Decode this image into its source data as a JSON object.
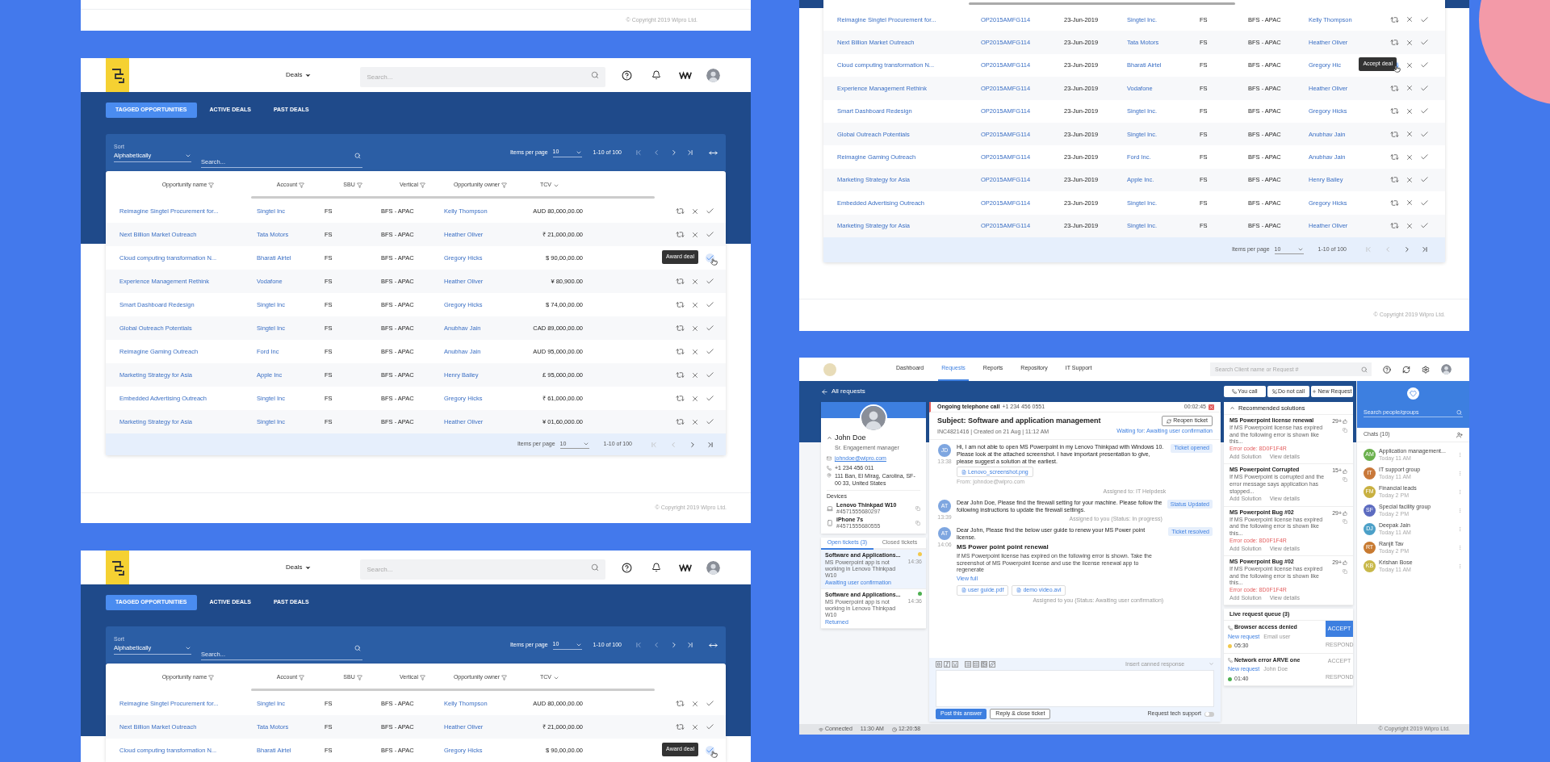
{
  "top_left_card": {
    "copyright": "© Copyright 2019 Wipro Ltd."
  },
  "deals_screen": {
    "menu": "Deals",
    "search_placeholder": "Search...",
    "tabs": [
      {
        "label": "TAGGED OPPORTUNITIES",
        "selected": true
      },
      {
        "label": "ACTIVE DEALS",
        "selected": false
      },
      {
        "label": "PAST DEALS",
        "selected": false
      }
    ],
    "filter": {
      "sort_label": "Sort",
      "sort_value": "Alphabetically",
      "search_placeholder": "Search...",
      "items_per_page_label": "Items per page",
      "items_per_page": "10",
      "range": "1-10 of 100"
    },
    "columns": [
      {
        "label": "Opportunity name",
        "kind": "filter"
      },
      {
        "label": "Account",
        "kind": "filter"
      },
      {
        "label": "SBU",
        "kind": "filter"
      },
      {
        "label": "Vertical",
        "kind": "filter"
      },
      {
        "label": "Opportunity owner",
        "kind": "filter"
      },
      {
        "label": "TCV",
        "kind": "sort"
      }
    ],
    "rows": [
      {
        "name": "Reimagine Singtel Procurement for...",
        "account": "Singtel Inc",
        "sbu": "FS",
        "vertical": "BFS - APAC",
        "owner": "Kelly Thompson",
        "tcv": "AUD 80,000,00.00"
      },
      {
        "name": "Next Billion Market Outreach",
        "account": "Tata Motors",
        "sbu": "FS",
        "vertical": "BFS - APAC",
        "owner": "Heather Oliver",
        "tcv": "₹ 21,000,00.00"
      },
      {
        "name": "Cloud computing transformation N...",
        "account": "Bharati Airtel",
        "sbu": "FS",
        "vertical": "BFS - APAC",
        "owner": "Gregory Hicks",
        "tcv": "$ 90,00,00.00",
        "tooltip": "Award deal",
        "accept_hovered": true
      },
      {
        "name": "Experience Management Rethink",
        "account": "Vodafone",
        "sbu": "FS",
        "vertical": "BFS - APAC",
        "owner": "Heather Oliver",
        "tcv": "¥ 80,900.00"
      },
      {
        "name": "Smart Dashboard Redesign",
        "account": "Singtel Inc",
        "sbu": "FS",
        "vertical": "BFS - APAC",
        "owner": "Gregory Hicks",
        "tcv": "$ 74,00,00.00"
      },
      {
        "name": "Global Outreach Potentials",
        "account": "Singtel Inc",
        "sbu": "FS",
        "vertical": "BFS - APAC",
        "owner": "Anubhav Jain",
        "tcv": "CAD 89,000,00.00"
      },
      {
        "name": "Reimagine Gaming Outreach",
        "account": "Ford Inc",
        "sbu": "FS",
        "vertical": "BFS - APAC",
        "owner": "Anubhav Jain",
        "tcv": "AUD 95,000,00.00"
      },
      {
        "name": "Marketing Strategy for Asia",
        "account": "Apple Inc",
        "sbu": "FS",
        "vertical": "BFS - APAC",
        "owner": "Henry Bailey",
        "tcv": "£ 95,000,00.00"
      },
      {
        "name": "Embedded Advertising Outreach",
        "account": "Singtel Inc",
        "sbu": "FS",
        "vertical": "BFS - APAC",
        "owner": "Gregory Hicks",
        "tcv": "₹ 61,000,00.00"
      },
      {
        "name": "Marketing Strategy for Asia",
        "account": "Singtel Inc",
        "sbu": "FS",
        "vertical": "BFS - APAC",
        "owner": "Heather Oliver",
        "tcv": "¥ 01,60,000.00"
      }
    ],
    "pagination": {
      "items_per_page_label": "Items per page",
      "items_per_page": "10",
      "range": "1-10 of 100"
    },
    "copyright": "© Copyright 2019 Wipro Ltd."
  },
  "deals_screen_2": {
    "menu": "Deals",
    "search_placeholder": "Search...",
    "tabs": [
      {
        "label": "TAGGED OPPORTUNITIES",
        "selected": true
      },
      {
        "label": "ACTIVE DEALS",
        "selected": false
      },
      {
        "label": "PAST DEALS",
        "selected": false
      }
    ],
    "filter": {
      "sort_label": "Sort",
      "sort_value": "Alphabetically",
      "search_placeholder": "Search...",
      "items_per_page_label": "Items per page",
      "items_per_page": "10",
      "range": "1-10 of 100"
    },
    "columns": [
      {
        "label": "Opportunity name",
        "kind": "filter"
      },
      {
        "label": "Account",
        "kind": "filter"
      },
      {
        "label": "SBU",
        "kind": "filter"
      },
      {
        "label": "Vertical",
        "kind": "filter"
      },
      {
        "label": "Opportunity owner",
        "kind": "filter"
      },
      {
        "label": "TCV",
        "kind": "sort"
      }
    ],
    "rows": [
      {
        "name": "Reimagine Singtel Procurement for...",
        "account": "Singtel Inc",
        "sbu": "FS",
        "vertical": "BFS - APAC",
        "owner": "Kelly Thompson",
        "tcv": "AUD 80,000,00.00"
      },
      {
        "name": "Next Billion Market Outreach",
        "account": "Tata Motors",
        "sbu": "FS",
        "vertical": "BFS - APAC",
        "owner": "Heather Oliver",
        "tcv": "₹ 21,000,00.00"
      },
      {
        "name": "Cloud computing transformation N...",
        "account": "Bharati Airtel",
        "sbu": "FS",
        "vertical": "BFS - APAC",
        "owner": "Gregory Hicks",
        "tcv": "$ 90,00,00.00",
        "tooltip": "Award deal",
        "accept_hovered": true
      }
    ]
  },
  "pipeline_screen": {
    "rows": [
      {
        "name": "Reimagine Singtel Procurement for...",
        "id": "OP2015AMFG114",
        "date": "23-Jun-2019",
        "account": "Singtel Inc.",
        "sbu": "FS",
        "vertical": "BFS - APAC",
        "owner": "Kelly Thompson"
      },
      {
        "name": "Next Billion Market Outreach",
        "id": "OP2015AMFG114",
        "date": "23-Jun-2019",
        "account": "Tata Motors",
        "sbu": "FS",
        "vertical": "BFS - APAC",
        "owner": "Heather Oliver"
      },
      {
        "name": "Cloud computing transformation N...",
        "id": "OP2015AMFG114",
        "date": "23-Jun-2019",
        "account": "Bharati Airtel",
        "sbu": "FS",
        "vertical": "BFS - APAC",
        "owner": "Gregory Hic",
        "tooltip": "Accept deal",
        "reassign_hovered": true
      },
      {
        "name": "Experience Management Rethink",
        "id": "OP2015AMFG114",
        "date": "23-Jun-2019",
        "account": "Vodafone",
        "sbu": "FS",
        "vertical": "BFS - APAC",
        "owner": "Heather Oliver"
      },
      {
        "name": "Smart Dashboard Redesign",
        "id": "OP2015AMFG114",
        "date": "23-Jun-2019",
        "account": "Singtel Inc.",
        "sbu": "FS",
        "vertical": "BFS - APAC",
        "owner": "Gregory Hicks"
      },
      {
        "name": "Global Outreach Potentials",
        "id": "OP2015AMFG114",
        "date": "23-Jun-2019",
        "account": "Singtel Inc.",
        "sbu": "FS",
        "vertical": "BFS - APAC",
        "owner": "Anubhav Jain"
      },
      {
        "name": "Reimagine Gaming Outreach",
        "id": "OP2015AMFG114",
        "date": "23-Jun-2019",
        "account": "Ford Inc.",
        "sbu": "FS",
        "vertical": "BFS - APAC",
        "owner": "Anubhav Jain"
      },
      {
        "name": "Marketing Strategy for Asia",
        "id": "OP2015AMFG114",
        "date": "23-Jun-2019",
        "account": "Apple Inc.",
        "sbu": "FS",
        "vertical": "BFS - APAC",
        "owner": "Henry Bailey"
      },
      {
        "name": "Embedded Advertising Outreach",
        "id": "OP2015AMFG114",
        "date": "23-Jun-2019",
        "account": "Singtel Inc.",
        "sbu": "FS",
        "vertical": "BFS - APAC",
        "owner": "Gregory Hicks"
      },
      {
        "name": "Marketing Strategy for Asia",
        "id": "OP2015AMFG114",
        "date": "23-Jun-2019",
        "account": "Singtel Inc.",
        "sbu": "FS",
        "vertical": "BFS - APAC",
        "owner": "Heather Oliver"
      }
    ],
    "pagination": {
      "items_per_page_label": "Items per page",
      "items_per_page": "10",
      "range": "1-10 of 100"
    },
    "copyright": "© Copyright 2019 Wipro Ltd."
  },
  "helpdesk_screen": {
    "nav": [
      {
        "label": "Dashboard",
        "selected": false
      },
      {
        "label": "Requests",
        "selected": true
      },
      {
        "label": "Reports",
        "selected": false
      },
      {
        "label": "Repository",
        "selected": false
      },
      {
        "label": "IT Support",
        "selected": false
      }
    ],
    "search_placeholder": "Search Client name or Request #",
    "back_label": "All requests",
    "profile": {
      "name": "John Doe",
      "role": "Sr. Engagement manager",
      "email": "johndoe@wipro.com",
      "phone": "+1 234 456 011",
      "address": "111 Ban, El Mirag, Carolina, SF-00 33, United States",
      "devices_label": "Devices",
      "devices": [
        {
          "kind": "laptop",
          "name": "Lenovo Thinkpad W10",
          "serial": "#4571555680297"
        },
        {
          "kind": "phone",
          "name": "iPhone 7s",
          "serial": "#4571555680555"
        }
      ]
    },
    "ticket_tabs": [
      {
        "label": "Open tickets (3)",
        "selected": true
      },
      {
        "label": "Closed tickets",
        "selected": false
      }
    ],
    "tickets": [
      {
        "title": "Software and Applications...",
        "description": "MS Powerpoint app is not working in Lenovo Thinkpad W10",
        "time": "14:36",
        "status": "Awaiting user confirmation",
        "color": "#f2c94c",
        "selected": true
      },
      {
        "title": "Software and Applications...",
        "description": "MS Powerpoint app is not working in Lenovo Thinkpad W10",
        "time": "14:36",
        "status": "Returned",
        "color": "#4caf50",
        "selected": false
      }
    ],
    "call": {
      "label": "Ongoing telephone call",
      "number": "+1 234 456 0551",
      "duration": "00:02:45"
    },
    "subject": "Subject: Software and application management",
    "meta": "INC4821416 | Created on 21 Aug | 11:12 AM",
    "reopen_label": "Reopen ticket",
    "waiting": "Waiting for: Awaiting user confirmation",
    "messages": [
      {
        "initials": "JD",
        "time": "13:38",
        "text": "Hi, I am not able to open MS Powerpoint in my Lenovo Thinkpad with Windows 10. Please look at the attached screenshot. I have important presentation to give, please suggest a solution at the earliest.",
        "tag": "Ticket opened",
        "attachments": [
          "Lenovo_screenshot.png"
        ],
        "from": "From: johndoe@wipro.com",
        "note": "Assigned to: IT Helpdesk"
      },
      {
        "initials": "AT",
        "time": "13:39",
        "text": "Dear John Doe, Please find the firewall setting for your machine. Please follow the following instructions to update the firewall settings.",
        "tag": "Status Updated",
        "note": "Assigned to you (Status: In progress)"
      },
      {
        "initials": "AT",
        "time": "14:06",
        "text": "Dear John, Please find the below user guide to renew your MS Power point license.",
        "heading": "MS Power point point renewal",
        "body": "If MS Powerpoint license has expired on the following error is shown. Take the screenshot of MS Powerpoint license and use the license renewal app to regenerate",
        "link": "View full",
        "tag": "Ticket resolved",
        "attachments": [
          "user guide.pdf",
          "demo video.avi"
        ],
        "note": "Assigned to you (Status: Awaiting user confirmation)"
      }
    ],
    "canned_placeholder": "Insert canned response",
    "post_label": "Post this answer",
    "reply_close_label": "Reply & close ticket",
    "tech_support": {
      "label": "Request tech support",
      "on": false
    },
    "status_bar": {
      "connection": "Connected",
      "time": "11:30 AM",
      "timer": "12:20:58"
    },
    "call_buttons": [
      {
        "kind": "call",
        "label": "You call"
      },
      {
        "kind": "mute",
        "label": "Do not call"
      },
      {
        "kind": "new",
        "label": "New Request"
      }
    ],
    "solutions_title": "Recommended solutions",
    "solutions": [
      {
        "title": "MS Powerpoint license renewal",
        "count": "29+",
        "text": "If MS Powerpoint license has expired and the following error is shown like this...",
        "error": "Error code: 8D0F1F4R",
        "add": "Add Solution",
        "view": "View details"
      },
      {
        "title": "MS Powerpoint Corrupted",
        "count": "15+",
        "text": "If MS Powerpoint is corrupted and the error message says application has stopped...",
        "add": "Add Solution",
        "view": "View details"
      },
      {
        "title": "MS Powerpoint Bug #02",
        "count": "29+",
        "text": "If MS Powerpoint license has expired and the following error is shown like this...",
        "error": "Error code: 8D0F1F4R",
        "add": "Add Solution",
        "view": "View details"
      },
      {
        "title": "MS Powerpoint Bug #02",
        "count": "29+",
        "text": "If MS Powerpoint license has expired and the following error is shown like this...",
        "error": "Error code: 8D0F1F4R",
        "add": "Add Solution",
        "view": "View details"
      }
    ],
    "queue_title": "Live request queue (3)",
    "queue": [
      {
        "title": "Browser access denied",
        "tag": "New request",
        "person": "Email user",
        "time": "05:30",
        "color": "#f2c94c",
        "accept": "ACCEPT",
        "respond": "RESPOND",
        "selected": true
      },
      {
        "title": "Network error ARVE one",
        "tag": "New request",
        "person": "John Doe",
        "time": "01:40",
        "color": "#4caf50",
        "accept": "ACCEPT",
        "respond": "RESPOND",
        "selected": false
      }
    ],
    "chat_search_placeholder": "Search people/groups",
    "chats_title": "Chats (10)",
    "chats": [
      {
        "initials": "AM",
        "name": "Application management...",
        "time": "Today 11 AM",
        "color": "#6ab04c"
      },
      {
        "initials": "IT",
        "name": "IT support group",
        "time": "Today 11 AM",
        "color": "#c8783a"
      },
      {
        "initials": "FM",
        "name": "Financial leads",
        "time": "Today 2 PM",
        "color": "#c8b040"
      },
      {
        "initials": "SF",
        "name": "Special facility group",
        "time": "Today 2 PM",
        "color": "#5c6bc0"
      },
      {
        "initials": "DJ",
        "name": "Deepak Jain",
        "time": "Today 11 AM",
        "color": "#4ca0c8"
      },
      {
        "initials": "RT",
        "name": "Ranjit Tav",
        "time": "Today 2 PM",
        "color": "#c87a30"
      },
      {
        "initials": "KB",
        "name": "Krishan Bose",
        "time": "Today 11 AM",
        "color": "#c8b84a"
      }
    ],
    "copyright": "© Copyright 2019 Wipro Ltd."
  }
}
